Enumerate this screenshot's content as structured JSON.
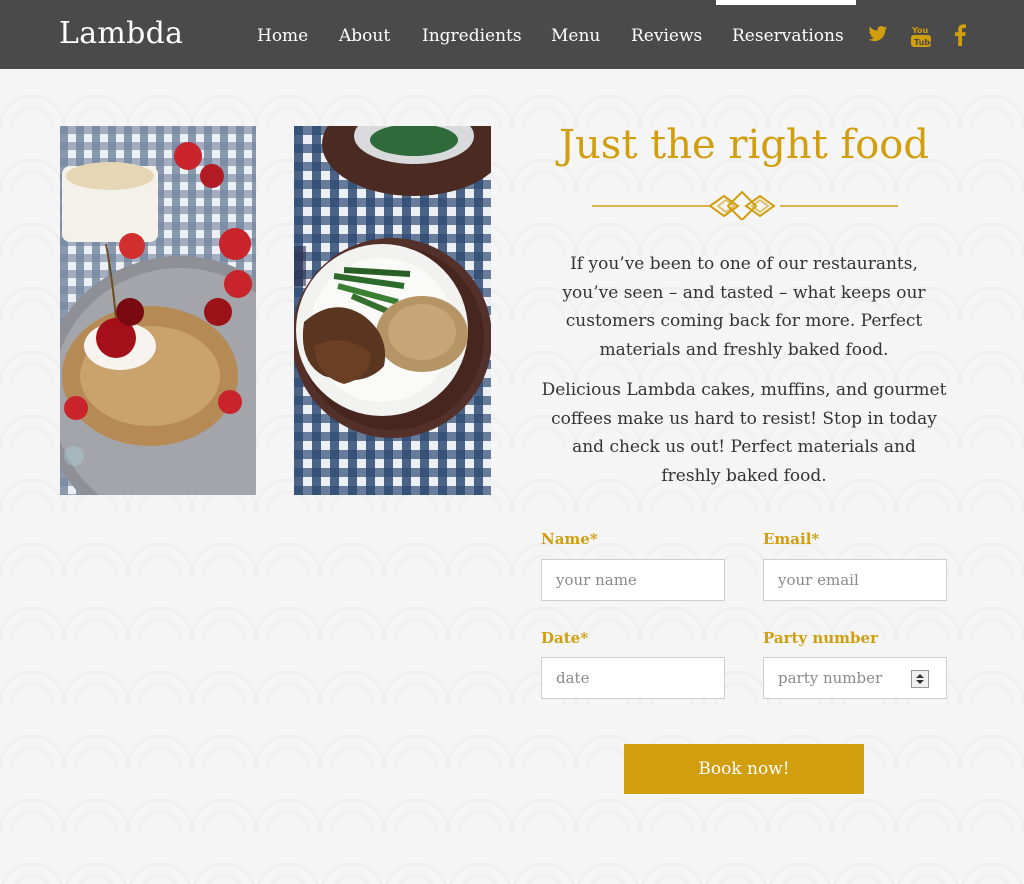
{
  "brand": "Lambda",
  "nav": {
    "links": [
      "Home",
      "About",
      "Ingredients",
      "Menu",
      "Reviews",
      "Reservations"
    ],
    "active": "Reservations",
    "social_icons": [
      "twitter-icon",
      "youtube-icon",
      "facebook-icon"
    ]
  },
  "hero": {
    "title": "Just the right food",
    "paragraphs": [
      "If you’ve been to one of our restaurants, you’ve seen – and tasted – what keeps our customers coming back for more. Perfect materials and freshly baked food.",
      "Delicious Lambda cakes, muffins, and gourmet coffees make us hard to resist! Stop in today and check us out! Perfect materials and freshly baked food."
    ]
  },
  "form": {
    "name_label": "Name*",
    "name_placeholder": "your name",
    "email_label": "Email*",
    "email_placeholder": "your email",
    "date_label": "Date*",
    "date_placeholder": "date",
    "party_label": "Party number",
    "party_placeholder": "party number",
    "submit_label": "Book now!"
  },
  "colors": {
    "accent": "#d19e0e",
    "navbar": "#4a4a4a",
    "text": "#333333"
  }
}
